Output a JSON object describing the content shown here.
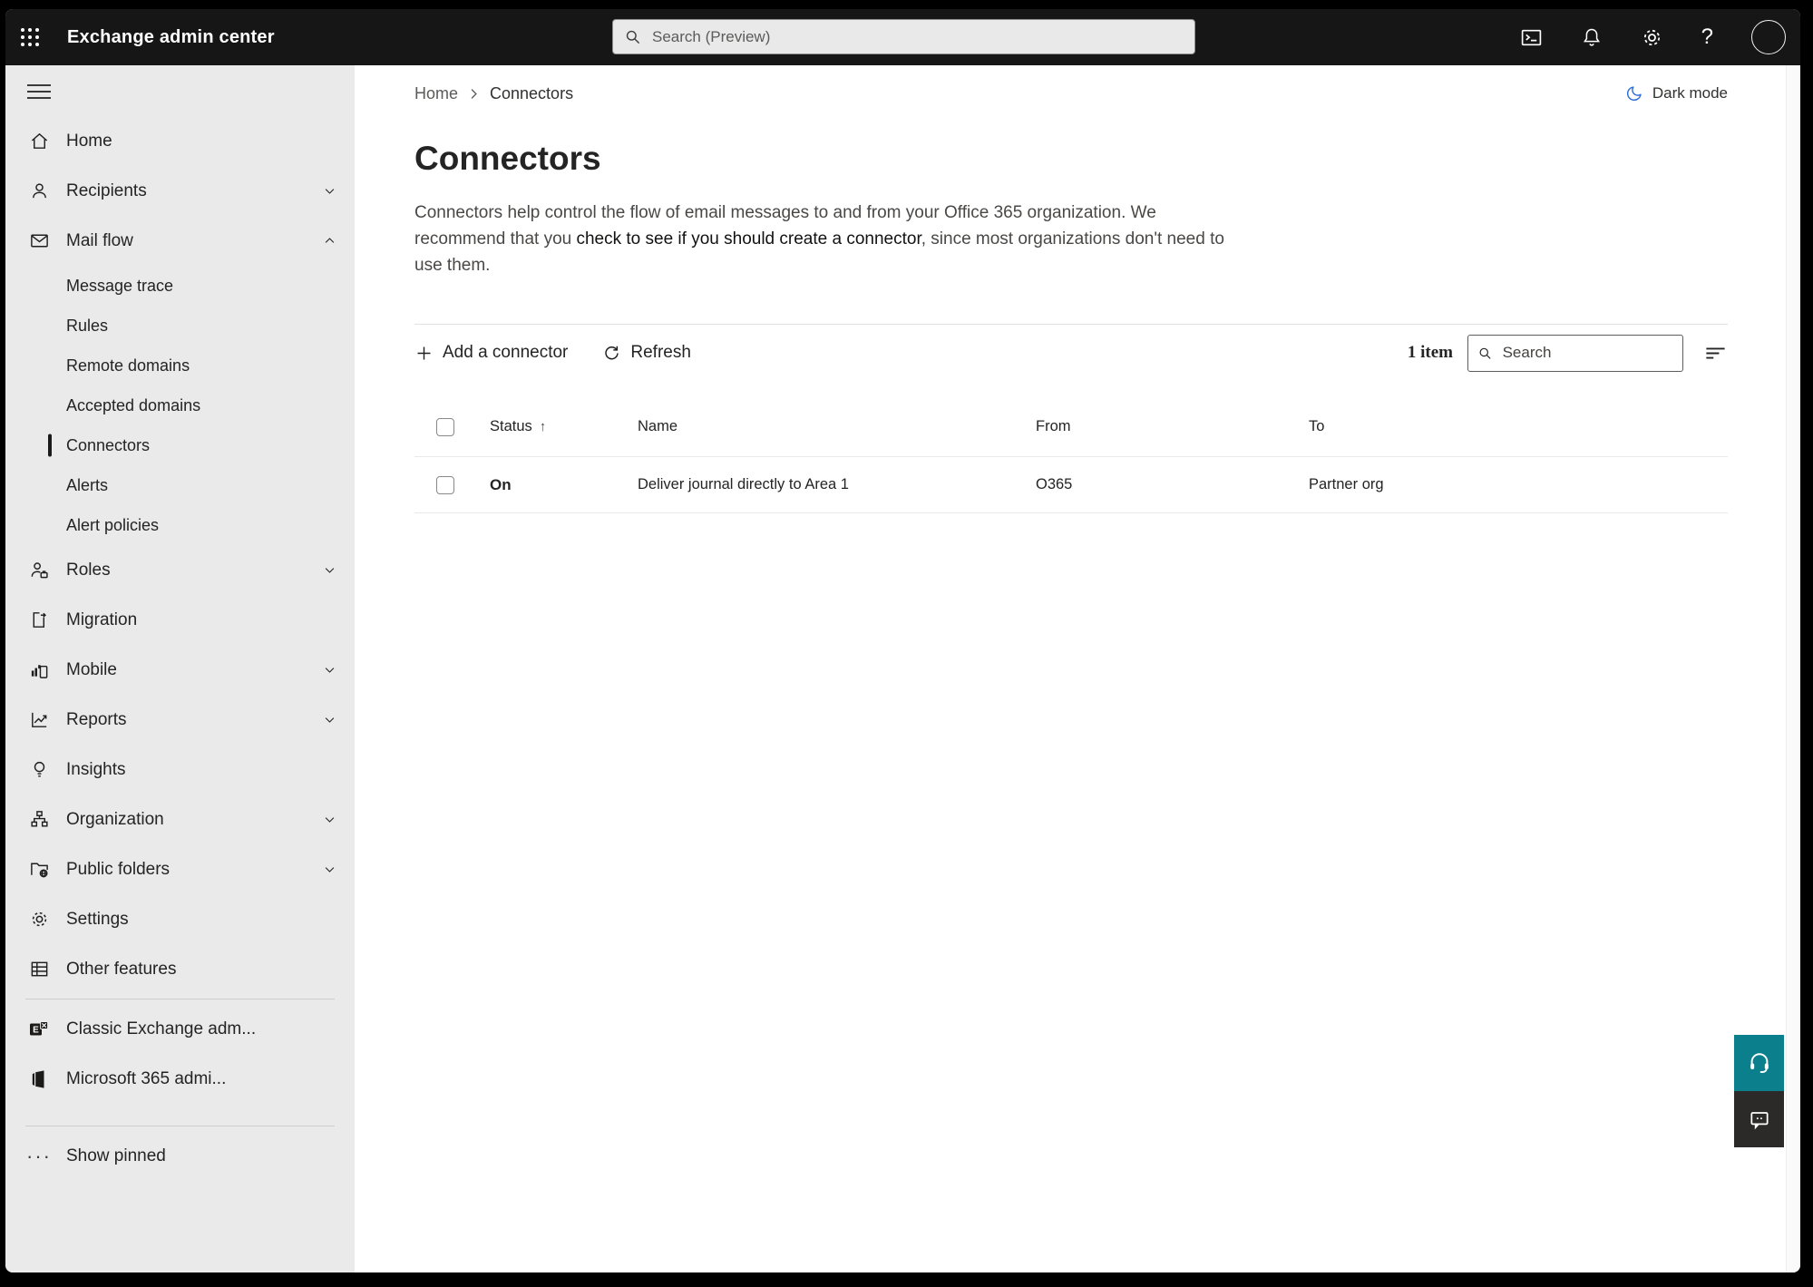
{
  "topbar": {
    "app_title": "Exchange admin center",
    "search_placeholder": "Search (Preview)"
  },
  "header": {
    "breadcrumb": [
      "Home",
      "Connectors"
    ],
    "dark_mode_label": "Dark mode"
  },
  "page": {
    "title": "Connectors",
    "description_pre": "Connectors help control the flow of email messages to and from your Office 365 organization. We recommend that you ",
    "description_link": "check to see if you should create a connector",
    "description_post": ", since most organizations don't need to use them."
  },
  "toolbar": {
    "add_label": "Add a connector",
    "refresh_label": "Refresh",
    "item_count": "1 item",
    "search_placeholder": "Search"
  },
  "table": {
    "columns": [
      "Status",
      "Name",
      "From",
      "To"
    ],
    "rows": [
      {
        "status": "On",
        "name": "Deliver journal directly to Area 1",
        "from": "O365",
        "to": "Partner org"
      }
    ]
  },
  "sidebar": {
    "items": [
      {
        "label": "Home"
      },
      {
        "label": "Recipients"
      },
      {
        "label": "Mail flow"
      },
      {
        "label": "Message trace"
      },
      {
        "label": "Rules"
      },
      {
        "label": "Remote domains"
      },
      {
        "label": "Accepted domains"
      },
      {
        "label": "Connectors"
      },
      {
        "label": "Alerts"
      },
      {
        "label": "Alert policies"
      },
      {
        "label": "Roles"
      },
      {
        "label": "Migration"
      },
      {
        "label": "Mobile"
      },
      {
        "label": "Reports"
      },
      {
        "label": "Insights"
      },
      {
        "label": "Organization"
      },
      {
        "label": "Public folders"
      },
      {
        "label": "Settings"
      },
      {
        "label": "Other features"
      },
      {
        "label": "Classic Exchange adm..."
      },
      {
        "label": "Microsoft 365 admi..."
      },
      {
        "label": "Show pinned"
      }
    ]
  },
  "colors": {
    "topbar_bg": "#161616",
    "sidebar_bg": "#eaeaea",
    "selected_indicator": "#1b1a19",
    "moon_blue": "#2b6cd9",
    "support_button_teal": "#0b7f8c",
    "feedback_button_dark": "#2b2a29"
  }
}
